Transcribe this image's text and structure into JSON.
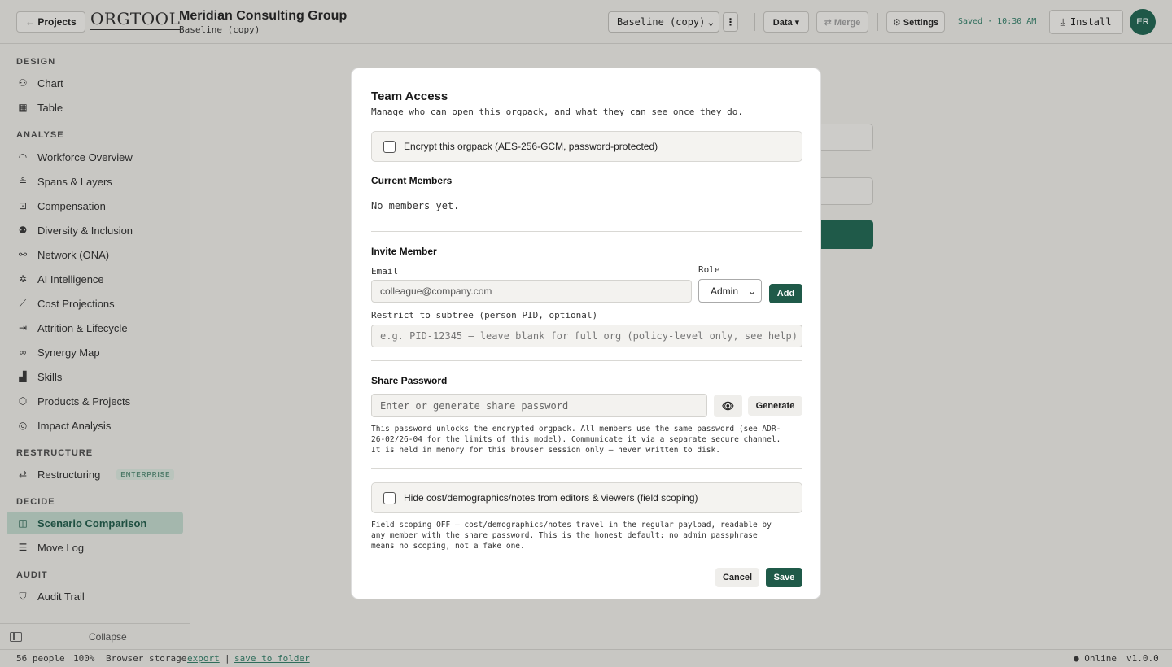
{
  "header": {
    "projects_label": "← Projects",
    "logo": "ORGTOOL",
    "org_name": "Meridian Consulting Group",
    "org_subtitle": "Baseline (copy)",
    "scenario_value": "Baseline (copy)",
    "kebab": "⋮",
    "data_label": "Data ▾",
    "merge_label": "⇄ Merge",
    "settings_label": "⚙ Settings",
    "saved_status": "Saved · 10:30 AM",
    "install_label": "Install",
    "avatar_initials": "ER"
  },
  "sidebar": {
    "sections": [
      {
        "title": "DESIGN",
        "items": [
          {
            "label": "Chart",
            "icon": "org-chart-icon"
          },
          {
            "label": "Table",
            "icon": "table-icon"
          }
        ]
      },
      {
        "title": "ANALYSE",
        "items": [
          {
            "label": "Workforce Overview",
            "icon": "gauge-icon"
          },
          {
            "label": "Spans & Layers",
            "icon": "layers-icon"
          },
          {
            "label": "Compensation",
            "icon": "money-icon"
          },
          {
            "label": "Diversity & Inclusion",
            "icon": "people-icon"
          },
          {
            "label": "Network (ONA)",
            "icon": "network-icon"
          },
          {
            "label": "AI Intelligence",
            "icon": "sparkle-icon"
          },
          {
            "label": "Cost Projections",
            "icon": "trend-icon"
          },
          {
            "label": "Attrition & Lifecycle",
            "icon": "exit-icon"
          },
          {
            "label": "Synergy Map",
            "icon": "overlap-icon"
          },
          {
            "label": "Skills",
            "icon": "bar-chart-icon"
          },
          {
            "label": "Products & Projects",
            "icon": "box-icon"
          },
          {
            "label": "Impact Analysis",
            "icon": "target-icon"
          }
        ]
      },
      {
        "title": "RESTRUCTURE",
        "items": [
          {
            "label": "Restructuring",
            "icon": "split-icon",
            "badge": "ENTERPRISE"
          }
        ]
      },
      {
        "title": "DECIDE",
        "items": [
          {
            "label": "Scenario Comparison",
            "icon": "columns-icon",
            "active": true
          },
          {
            "label": "Move Log",
            "icon": "list-icon"
          }
        ]
      },
      {
        "title": "AUDIT",
        "items": [
          {
            "label": "Audit Trail",
            "icon": "shield-icon"
          }
        ]
      }
    ],
    "collapse_label": "Collapse"
  },
  "footer": {
    "people": "56 people",
    "zoom": "100%",
    "storage": "Browser storage",
    "export": "export",
    "sep": "|",
    "save_folder": "save to folder",
    "status": "● Online",
    "version": "v1.0.0"
  },
  "modal": {
    "title": "Team Access",
    "subtitle": "Manage who can open this orgpack, and what they can see once they do.",
    "encrypt_label": "Encrypt this orgpack (AES-256-GCM, password-protected)",
    "current_members_heading": "Current Members",
    "no_members": "No members yet.",
    "invite_heading": "Invite Member",
    "email_label": "Email",
    "email_placeholder": "colleague@company.com",
    "role_label": "Role",
    "role_value": "Admin",
    "add_label": "Add",
    "subtree_label": "Restrict to subtree (person PID, optional)",
    "subtree_placeholder": "e.g. PID-12345 — leave blank for full org (policy-level only, see help)",
    "share_heading": "Share Password",
    "password_placeholder": "Enter or generate share password",
    "eye_icon": "👁",
    "generate_label": "Generate",
    "password_note_1": "This password unlocks the encrypted orgpack. All members use the same password (see ADR-",
    "password_note_2": "26-02/26-04 for the limits of this model). Communicate it via a separate secure channel.",
    "password_note_3": "It is held in memory for this browser session only — never written to disk.",
    "hide_label": "Hide cost/demographics/notes from editors & viewers (field scoping)",
    "scoping_note_1": "Field scoping OFF — cost/demographics/notes travel in the regular payload, readable by",
    "scoping_note_2": "any member with the share password. This is the honest default: no admin passphrase",
    "scoping_note_3": "means no scoping, not a fake one.",
    "cancel_label": "Cancel",
    "save_label": "Save"
  },
  "colors": {
    "accent": "#1f5a49",
    "overlay": "#c9c8c4",
    "active_nav": "#a4b7ad"
  }
}
